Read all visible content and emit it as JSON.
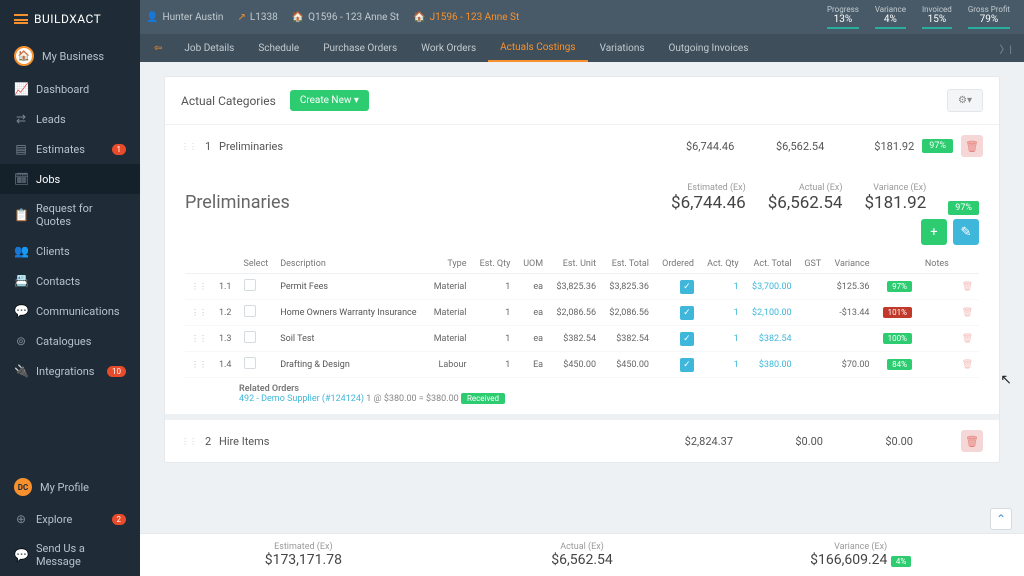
{
  "brand": {
    "name": "BUILDXACT"
  },
  "sidebar": {
    "items": [
      {
        "label": "My Business",
        "icon": "biz"
      },
      {
        "label": "Dashboard",
        "icon": "📈"
      },
      {
        "label": "Leads",
        "icon": "⇄"
      },
      {
        "label": "Estimates",
        "icon": "▤",
        "badge": "1"
      },
      {
        "label": "Jobs",
        "icon": "🗓",
        "active": true
      },
      {
        "label": "Request for Quotes",
        "icon": "📋"
      },
      {
        "label": "Clients",
        "icon": "👥"
      },
      {
        "label": "Contacts",
        "icon": "📇"
      },
      {
        "label": "Communications",
        "icon": "💬"
      },
      {
        "label": "Catalogues",
        "icon": "⊚"
      },
      {
        "label": "Integrations",
        "icon": "🔌",
        "badge": "10"
      }
    ],
    "bottom": [
      {
        "label": "My Profile",
        "icon": "DC",
        "profile": true
      },
      {
        "label": "Explore",
        "icon": "⊕",
        "badge": "2"
      },
      {
        "label": "Send Us a Message",
        "icon": "💬"
      }
    ]
  },
  "breadcrumbs": [
    {
      "icon": "👤",
      "label": "Hunter Austin",
      "muted": true
    },
    {
      "icon": "↗",
      "label": "L1338",
      "muted": true
    },
    {
      "icon": "🏠",
      "label": "Q1596 - 123 Anne St",
      "muted": true
    },
    {
      "icon": "🏠",
      "label": "J1596 - 123 Anne St"
    }
  ],
  "metrics": [
    {
      "label": "Progress",
      "value": "13%"
    },
    {
      "label": "Variance",
      "value": "4%"
    },
    {
      "label": "Invoiced",
      "value": "15%"
    },
    {
      "label": "Gross Profit",
      "value": "79%"
    }
  ],
  "tabs": [
    "Job Details",
    "Schedule",
    "Purchase Orders",
    "Work Orders",
    "Actuals Costings",
    "Variations",
    "Outgoing Invoices"
  ],
  "active_tab": "Actuals Costings",
  "categories_title": "Actual Categories",
  "create_new": "Create New ▾",
  "cat1": {
    "num": "1",
    "name": "Preliminaries",
    "est": "$6,744.46",
    "act": "$6,562.54",
    "var": "$181.92",
    "prog": "97%"
  },
  "detail": {
    "title": "Preliminaries",
    "est_label": "Estimated (Ex)",
    "est": "$6,744.46",
    "act_label": "Actual (Ex)",
    "act": "$6,562.54",
    "var_label": "Variance (Ex)",
    "var": "$181.92",
    "prog": "97%"
  },
  "cols": {
    "select": "Select",
    "desc": "Description",
    "type": "Type",
    "eqty": "Est. Qty",
    "uom": "UOM",
    "eunit": "Est. Unit",
    "etotal": "Est. Total",
    "ordered": "Ordered",
    "aqty": "Act. Qty",
    "atotal": "Act. Total",
    "gst": "GST",
    "variance": "Variance",
    "notes": "Notes"
  },
  "rows": [
    {
      "n": "1.1",
      "desc": "Permit Fees",
      "type": "Material",
      "eqty": "1",
      "uom": "ea",
      "eunit": "$3,825.36",
      "etotal": "$3,825.36",
      "aqty": "1",
      "atotal": "$3,700.00",
      "gst": "",
      "var": "$125.36",
      "pill": "97%",
      "pc": "g"
    },
    {
      "n": "1.2",
      "desc": "Home Owners Warranty Insurance",
      "type": "Material",
      "eqty": "1",
      "uom": "ea",
      "eunit": "$2,086.56",
      "etotal": "$2,086.56",
      "aqty": "1",
      "atotal": "$2,100.00",
      "gst": "",
      "var": "-$13.44",
      "pill": "101%",
      "pc": "r"
    },
    {
      "n": "1.3",
      "desc": "Soil Test",
      "type": "Material",
      "eqty": "1",
      "uom": "ea",
      "eunit": "$382.54",
      "etotal": "$382.54",
      "aqty": "1",
      "atotal": "$382.54",
      "gst": "",
      "var": "",
      "pill": "100%",
      "pc": "g"
    },
    {
      "n": "1.4",
      "desc": "Drafting & Design",
      "type": "Labour",
      "eqty": "1",
      "uom": "Ea",
      "eunit": "$450.00",
      "etotal": "$450.00",
      "aqty": "1",
      "atotal": "$380.00",
      "gst": "",
      "var": "$70.00",
      "pill": "84%",
      "pc": "g"
    }
  ],
  "related": {
    "title": "Related Orders",
    "order": "492 - Demo Supplier (#124124)",
    "qty": "1 @ $380.00 = $380.00",
    "status": "Received"
  },
  "cat2": {
    "num": "2",
    "name": "Hire Items",
    "est": "$2,824.37",
    "act": "$0.00",
    "var": "$0.00"
  },
  "footer": {
    "el": "Estimated (Ex)",
    "ev": "$173,171.78",
    "al": "Actual (Ex)",
    "av": "$6,562.54",
    "vl": "Variance (Ex)",
    "vv": "$166,609.24",
    "vp": "4%"
  }
}
